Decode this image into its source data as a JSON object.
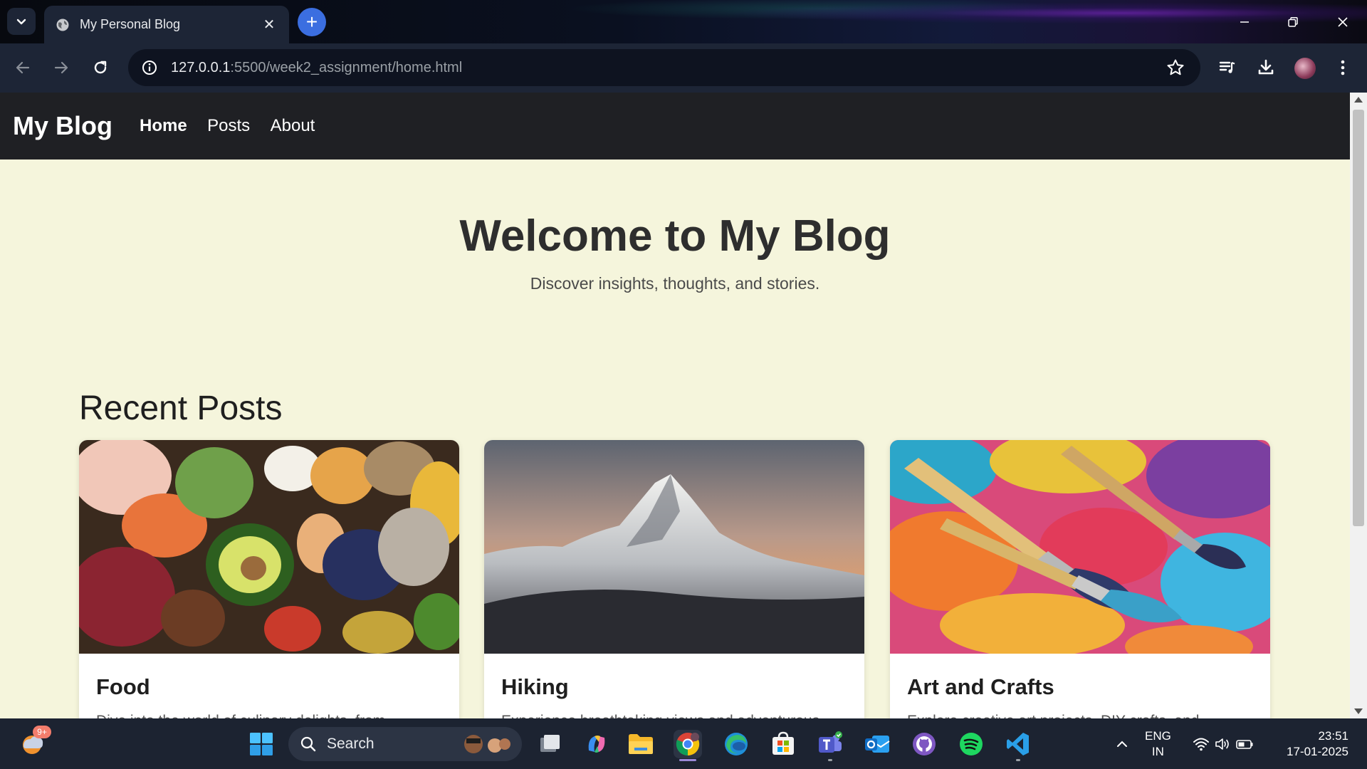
{
  "browser": {
    "tab_title": "My Personal Blog",
    "url_host": "127.0.0.1",
    "url_path": ":5500/week2_assignment/home.html"
  },
  "site": {
    "logo": "My Blog",
    "nav": [
      "Home",
      "Posts",
      "About"
    ],
    "active_nav": "Home",
    "hero_title": "Welcome to My Blog",
    "hero_subtitle": "Discover insights, thoughts, and stories.",
    "section_title": "Recent Posts",
    "cards": [
      {
        "title": "Food",
        "excerpt": "Dive into the world of culinary delights, from",
        "image": "food-photo"
      },
      {
        "title": "Hiking",
        "excerpt": "Experience breathtaking views and adventurous",
        "image": "mountain-photo"
      },
      {
        "title": "Art and Crafts",
        "excerpt": "Explore creative art projects, DIY crafts, and",
        "image": "paint-brushes-photo"
      }
    ],
    "colors": {
      "page_bg": "#f5f5dc",
      "header_bg": "#1f2024"
    }
  },
  "taskbar": {
    "search_label": "Search",
    "widget_badge": "9+",
    "lang_primary": "ENG",
    "lang_secondary": "IN",
    "time": "23:51",
    "date": "17-01-2025"
  }
}
